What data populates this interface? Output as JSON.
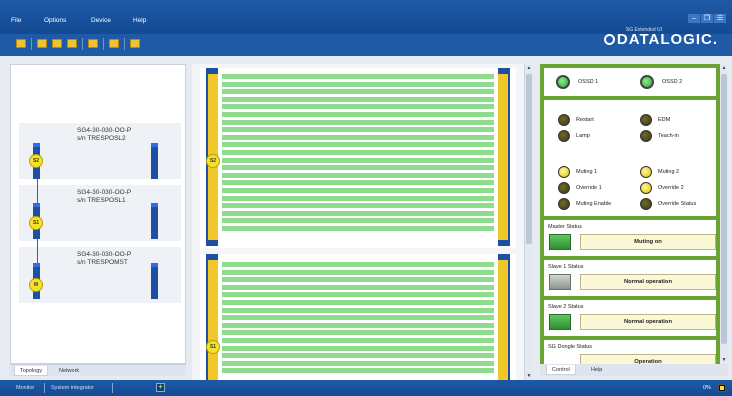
{
  "menu": {
    "items": [
      "File",
      "Options",
      "Device",
      "Help"
    ]
  },
  "window_controls": [
    "–",
    "❐",
    "☰"
  ],
  "brand": {
    "subtitle": "SG Extended UI",
    "name": "DATALOGIC."
  },
  "toolbar": {
    "icons": [
      "folder-icon",
      "folder-icon",
      "folder-icon",
      "folder-icon",
      "folder-icon",
      "folder-icon",
      "folder-icon"
    ]
  },
  "topology": {
    "devices": [
      {
        "model": "SG4-30-030-OO-P",
        "serial": "s/n TRESPOSL2",
        "node": "S2"
      },
      {
        "model": "SG4-30-030-OO-P",
        "serial": "s/n TRESPOSL1",
        "node": "S1"
      },
      {
        "model": "SG4-30-030-OO-P",
        "serial": "s/n TRESPOMST",
        "node": "M"
      }
    ],
    "tabs": [
      "Topology",
      "Network"
    ]
  },
  "curtain": {
    "upper_node": "S2",
    "lower_node": "S1",
    "upper_beams": 21,
    "lower_beams": 15
  },
  "status": {
    "ossd": [
      {
        "label": "OSSD 1"
      },
      {
        "label": "OSSD 2"
      }
    ],
    "signals_a": [
      {
        "label": "Restart",
        "state": "off"
      },
      {
        "label": "EDM",
        "state": "off"
      },
      {
        "label": "Lamp",
        "state": "off"
      },
      {
        "label": "Teach-in",
        "state": "off"
      }
    ],
    "signals_b": [
      {
        "label": "Muting 1",
        "state": "on"
      },
      {
        "label": "Muting 2",
        "state": "on"
      },
      {
        "label": "Override 1",
        "state": "off"
      },
      {
        "label": "Override 2",
        "state": "on"
      },
      {
        "label": "Muting Enable",
        "state": "off"
      },
      {
        "label": "Override Status",
        "state": "off"
      }
    ],
    "master": {
      "title": "Master Status",
      "value": "Muting on"
    },
    "slave1": {
      "title": "Slave 1 Status",
      "value": "Normal operation"
    },
    "slave2": {
      "title": "Slave 2 Status",
      "value": "Normal operation"
    },
    "dongle": {
      "title": "SG Dongle Status",
      "value": "Operation"
    },
    "tabs": [
      "Control",
      "Help"
    ]
  },
  "bottom": {
    "monitor": "Monitor",
    "integrator": "System integrator",
    "add": "+",
    "pct": "0%"
  }
}
